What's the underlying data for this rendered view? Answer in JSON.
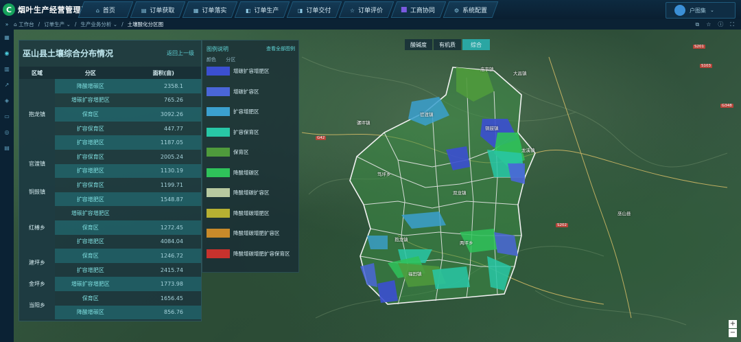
{
  "app": {
    "title": "烟叶生产经营管理平台",
    "logo_letter": "C"
  },
  "nav": [
    {
      "label": "首页",
      "icon": "home-icon"
    },
    {
      "label": "订单获取",
      "icon": "inbox-icon"
    },
    {
      "label": "订单落实",
      "icon": "clipboard-icon"
    },
    {
      "label": "订单生产",
      "icon": "tractor-icon"
    },
    {
      "label": "订单交付",
      "icon": "truck-icon"
    },
    {
      "label": "订单评价",
      "icon": "star-icon"
    },
    {
      "label": "工商协同",
      "icon": "handshake-icon"
    },
    {
      "label": "系统配置",
      "icon": "gear-icon"
    }
  ],
  "user": {
    "name": "户图集"
  },
  "breadcrumb": {
    "home": "工作台",
    "items": [
      "订单生产",
      "生产业务分析",
      "土壤酸化分区图"
    ]
  },
  "layer_tabs": [
    "酸碱度",
    "有机质",
    "综合"
  ],
  "layer_tab_active": 2,
  "panel": {
    "title": "巫山县土壤综合分布情况",
    "back_link": "返回上一级",
    "columns": [
      "区域",
      "分区",
      "面积(亩)"
    ],
    "rows": [
      {
        "town": "抱龙镇",
        "zone": "降酸增碳区",
        "area": "2358.1"
      },
      {
        "town": "",
        "zone": "增碳扩容增肥区",
        "area": "765.26"
      },
      {
        "town": "",
        "zone": "保育区",
        "area": "3092.26"
      },
      {
        "town": "",
        "zone": "扩容保育区",
        "area": "447.77"
      },
      {
        "town": "",
        "zone": "扩容增肥区",
        "area": "1187.05"
      },
      {
        "town": "官渡镇",
        "zone": "扩容保育区",
        "area": "2005.24"
      },
      {
        "town": "",
        "zone": "扩容增肥区",
        "area": "1130.19"
      },
      {
        "town": "铜鼓镇",
        "zone": "扩容保育区",
        "area": "1199.71"
      },
      {
        "town": "",
        "zone": "扩容增肥区",
        "area": "1548.87"
      },
      {
        "town": "红椿乡",
        "zone": "增碳扩容增肥区",
        "area": ""
      },
      {
        "town": "",
        "zone": "保育区",
        "area": "1272.45"
      },
      {
        "town": "",
        "zone": "扩容增肥区",
        "area": "4084.04"
      },
      {
        "town": "建坪乡",
        "zone": "保育区",
        "area": "1246.72"
      },
      {
        "town": "",
        "zone": "扩容增肥区",
        "area": "2415.74"
      },
      {
        "town": "金坪乡",
        "zone": "增碳扩容增肥区",
        "area": "1773.98"
      },
      {
        "town": "当阳乡",
        "zone": "保育区",
        "area": "1656.45"
      },
      {
        "town": "",
        "zone": "降酸增碳区",
        "area": "856.76"
      }
    ]
  },
  "legend": {
    "title": "图例说明",
    "more": "查看全部图例",
    "col_color": "颜色",
    "col_zone": "分区",
    "items": [
      {
        "label": "增碳扩容增肥区",
        "color": "#3b4fd0"
      },
      {
        "label": "增碳扩容区",
        "color": "#4a66d8"
      },
      {
        "label": "扩容增肥区",
        "color": "#3ba0cf"
      },
      {
        "label": "扩容保育区",
        "color": "#28c7a6"
      },
      {
        "label": "保育区",
        "color": "#4f9a3c"
      },
      {
        "label": "降酸增碳区",
        "color": "#2fc25a"
      },
      {
        "label": "降酸增碳扩容区",
        "color": "#b8c9a0"
      },
      {
        "label": "降酸增碳增肥区",
        "color": "#b6b032"
      },
      {
        "label": "降酸增碳增肥扩容区",
        "color": "#c88a2a"
      },
      {
        "label": "降酸增碳增肥扩容保育区",
        "color": "#c7322d"
      }
    ]
  },
  "map_labels": [
    "庙宇镇",
    "官渡镇",
    "铜鼓镇",
    "骡坪镇",
    "龙溪镇",
    "笃坪乡",
    "双龙镇",
    "抱龙镇",
    "巫山县",
    "两坪乡",
    "福田镇",
    "大昌镇"
  ],
  "road_labels": [
    "G42",
    "S201",
    "S103",
    "G348",
    "S202"
  ]
}
